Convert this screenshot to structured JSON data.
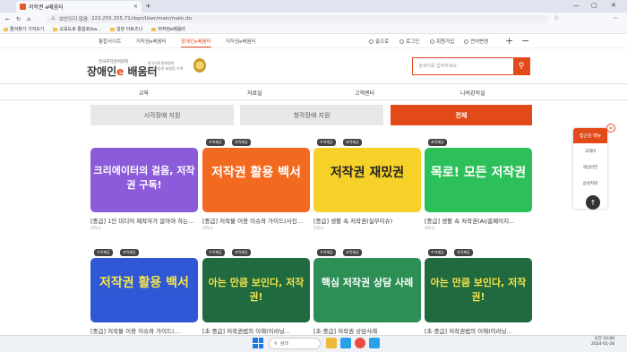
{
  "browser": {
    "tab_title": "저작권 e배움터",
    "url_security": "보안되지 않음",
    "url": "223.255.255.71/dspr/User/main/main.do",
    "bookmarks": [
      "즐겨찾기 가져오기",
      "교육도로 통합포(ka…",
      "일본 아토즈나",
      "저작권e배움터"
    ]
  },
  "topnav": {
    "items": [
      "통합사이트",
      "저작권e배움터",
      "장애인e배움터",
      "저작권e배움터"
    ],
    "utils": [
      "출으로",
      "로그인",
      "회원가입",
      "언어변경"
    ]
  },
  "header": {
    "logo_sub": "한국저작권위원회",
    "logo_main": "장애인",
    "logo_e": "e",
    "logo_tail": " 배움터",
    "award_l1": "한국저작권위원회",
    "award_l2": "교육부장관 표창장 수여",
    "search_placeholder": "검색어를 입력하세요."
  },
  "gnb": [
    "교육",
    "자료실",
    "고객센터",
    "나의강의실"
  ],
  "filters": [
    "시각장애 지원",
    "청각장애 지원",
    "전체"
  ],
  "cards": [
    {
      "big": "크리에이터의 걸음, 저작권 구독!",
      "title": "[중급] 1인 미디어 제작자가 알아야 하는…",
      "meta": "2차시",
      "badges": []
    },
    {
      "big": "저작권 활용 백서",
      "title": "[중급] 저작물 이용 이슈와 가이드(사진…",
      "meta": "3차시",
      "badges": [
        "수어제공",
        "자막제공"
      ]
    },
    {
      "big": "저작권 재밌권",
      "title": "[중급] 생활 속 저작권(실무이슈)",
      "meta": "5차시",
      "badges": [
        "수어제공",
        "자막제공"
      ]
    },
    {
      "big": "목로! 모든 저작권",
      "title": "[중급] 생활 속 저작권(AI/홈페이지…",
      "meta": "4차시",
      "badges": [
        "자막제공"
      ]
    },
    {
      "big": "저작권 활용 백서",
      "title": "[중급] 저작물 이용 이슈와 가이드(…",
      "meta": "",
      "badges": [
        "수어제공",
        "자막제공"
      ]
    },
    {
      "big": "아는 만큼 보인다, 저작권!",
      "title": "[초·중급] 저작권법의 이해(이러닝…",
      "meta": "",
      "badges": [
        "수어제공",
        "자막제공"
      ]
    },
    {
      "big": "핵심 저작권 상담 사례",
      "title": "[초·중급] 저작권 상담사례",
      "meta": "",
      "badges": [
        "수어제공",
        "자막제공"
      ]
    },
    {
      "big": "아는 만큼 보인다, 저작권!",
      "title": "[초·중급] 저작권법의 이해(이러닝…",
      "meta": "",
      "badges": [
        "수어제공",
        "자막제공"
      ]
    }
  ],
  "side": {
    "header": "접근성 메뉴",
    "items": [
      "고대비",
      "색상반전",
      "음성지원"
    ]
  },
  "taskbar": {
    "search": "검색",
    "time": "오전 10:00",
    "date": "2024-01-26"
  },
  "colors": {
    "accent": "#e24a1a"
  }
}
